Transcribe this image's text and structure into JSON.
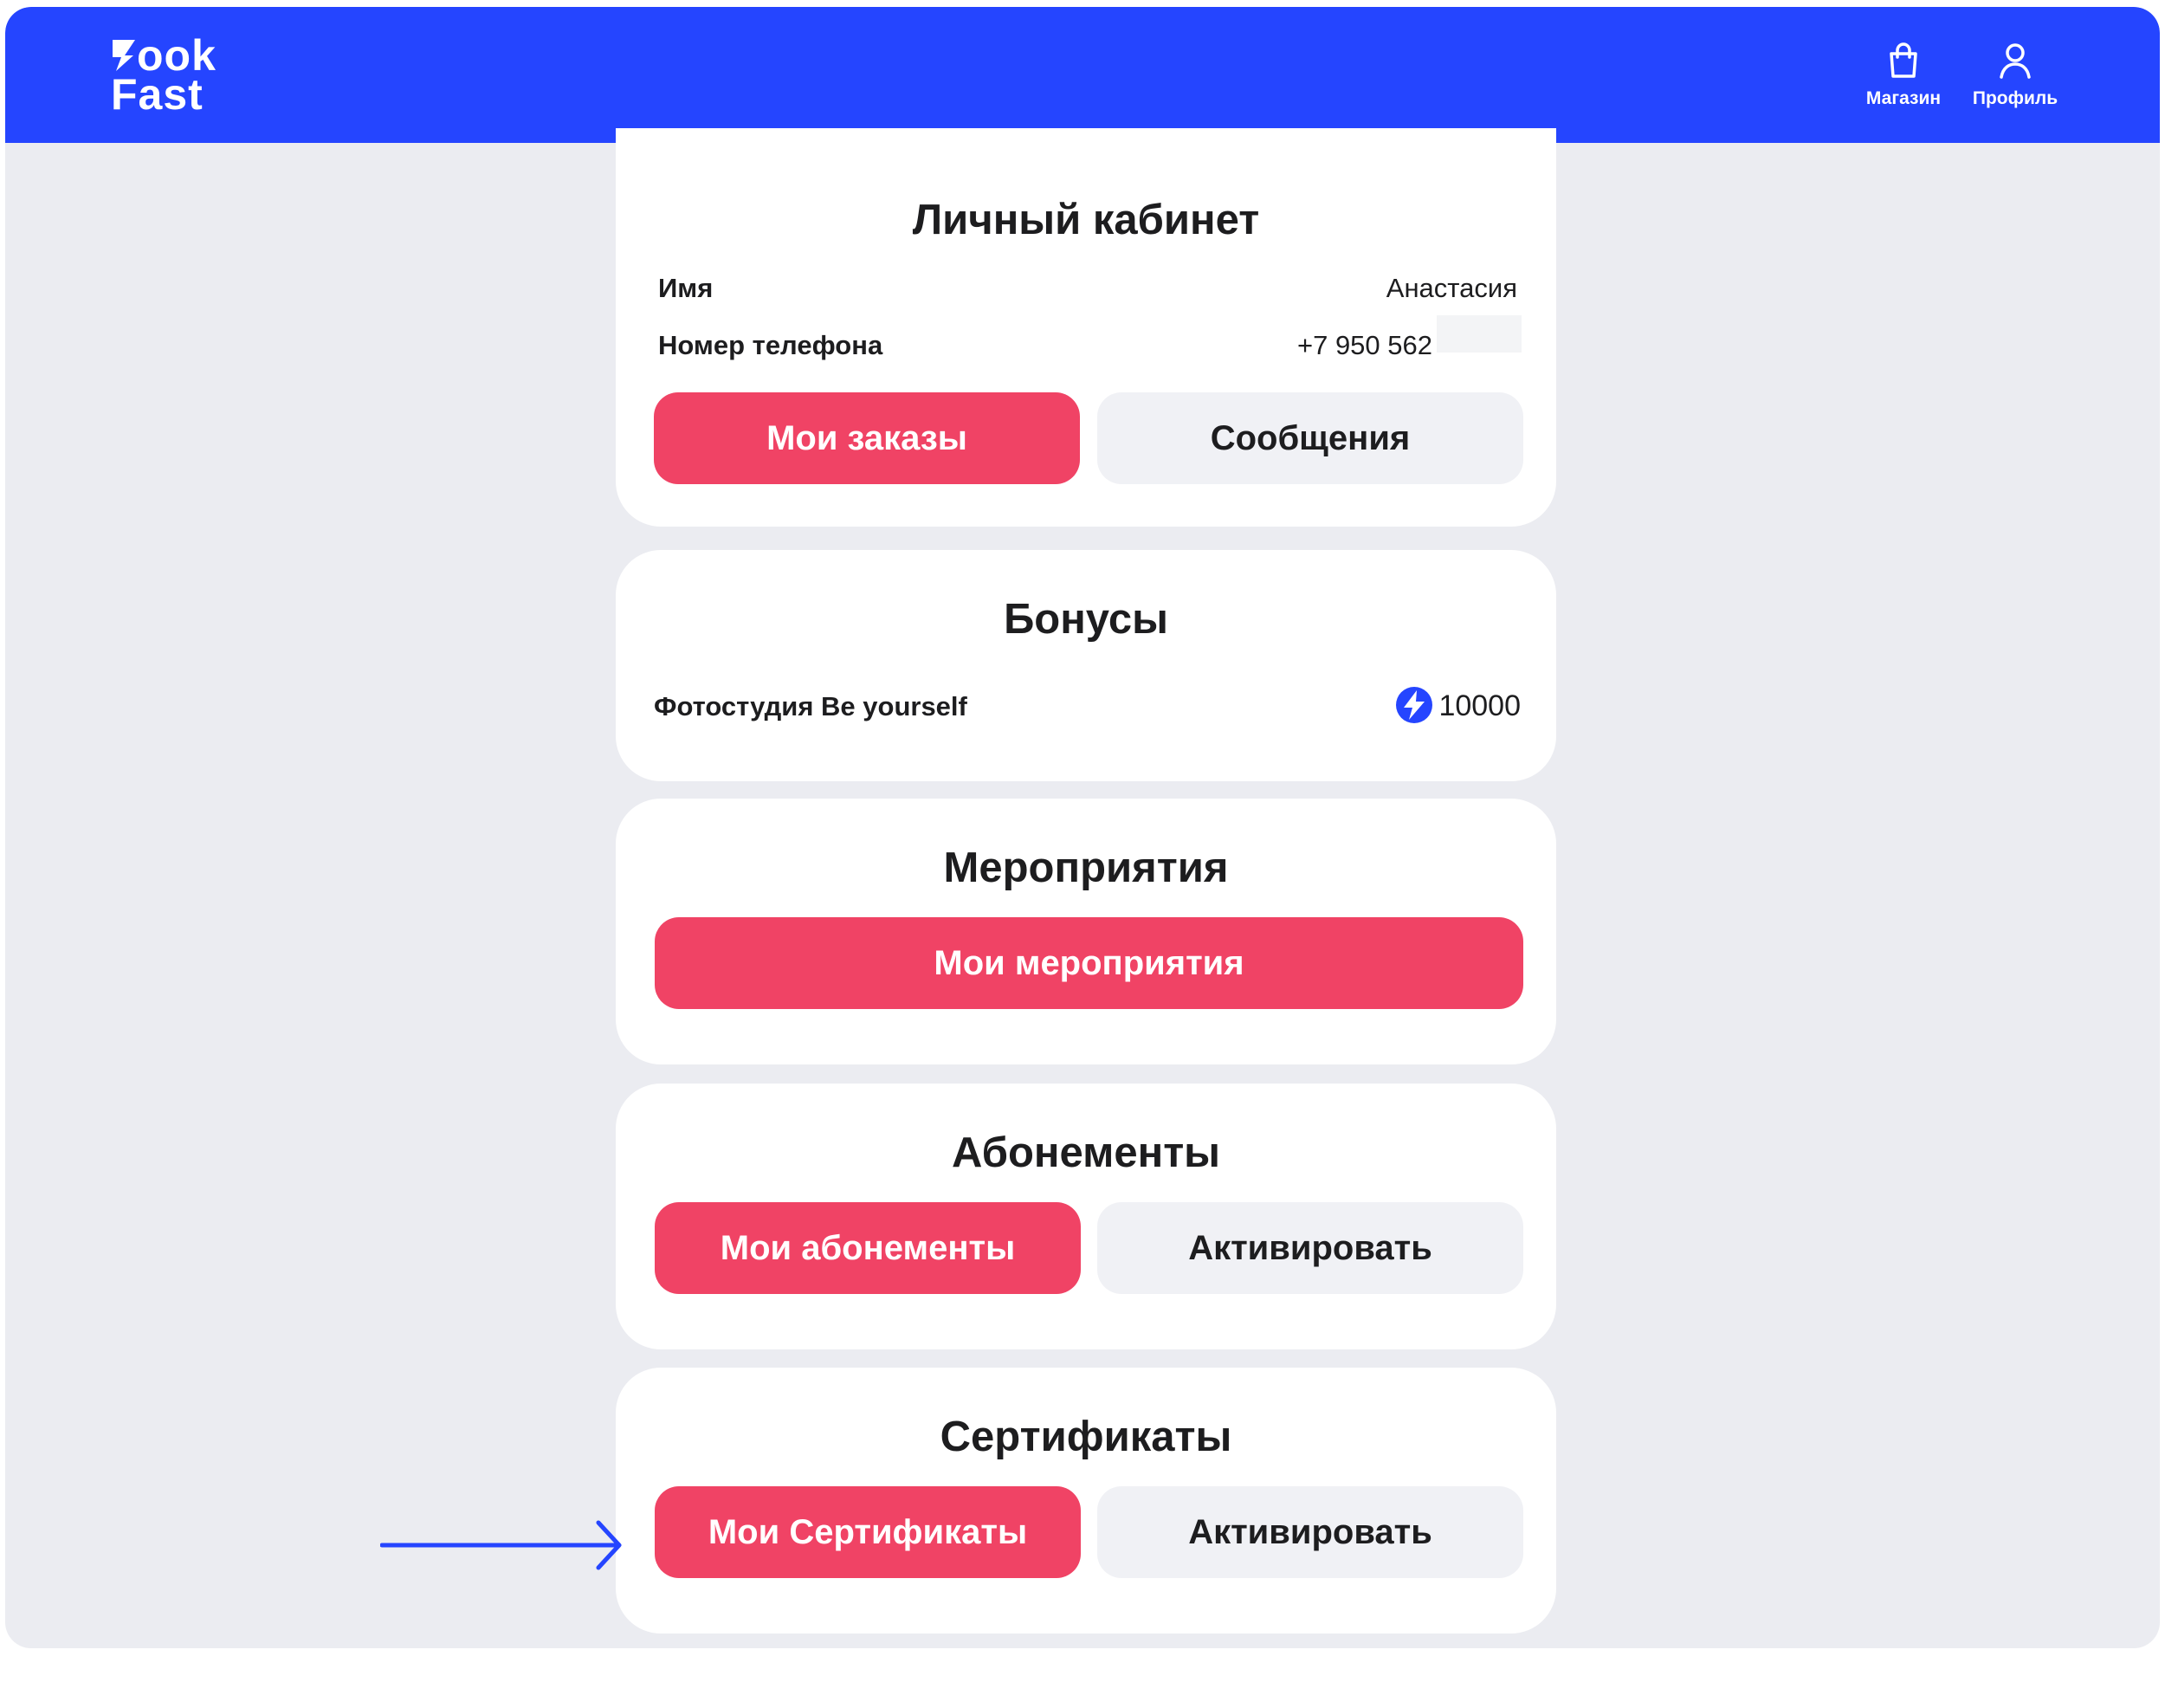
{
  "brand": {
    "logo_line1": "ook",
    "logo_line2": "Fast",
    "accent_color": "#2545ff",
    "primary_button_color": "#f04365"
  },
  "header": {
    "nav": [
      {
        "label": "Магазин",
        "icon": "shopping-bag-icon"
      },
      {
        "label": "Профиль",
        "icon": "user-icon"
      }
    ]
  },
  "account": {
    "title": "Личный кабинет",
    "name_label": "Имя",
    "name_value": "Анастасия",
    "phone_label": "Номер телефона",
    "phone_value": "+7 950 562",
    "orders_button": "Мои заказы",
    "messages_button": "Сообщения"
  },
  "bonuses": {
    "title": "Бонусы",
    "studio": "Фотостудия Be yourself",
    "amount": "10000",
    "icon": "bolt-icon"
  },
  "events": {
    "title": "Мероприятия",
    "my_events_button": "Мои мероприятия"
  },
  "subscriptions": {
    "title": "Абонементы",
    "my_button": "Мои абонементы",
    "activate_button": "Активировать"
  },
  "certificates": {
    "title": "Сертификаты",
    "my_button": "Мои Сертификаты",
    "activate_button": "Активировать",
    "pointer": "arrow-right-icon"
  }
}
